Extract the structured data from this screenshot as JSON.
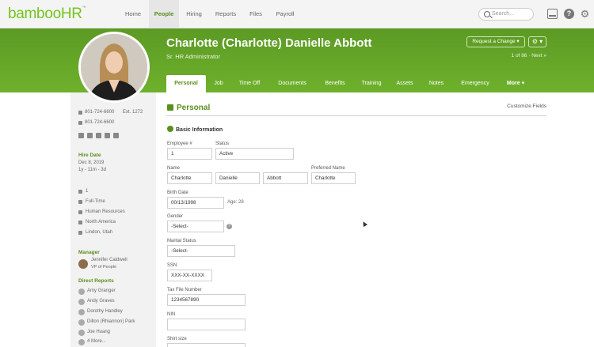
{
  "nav": {
    "logo": "bambooHR",
    "logo_tm": "™",
    "items": [
      "Home",
      "People",
      "Hiring",
      "Reports",
      "Files",
      "Payroll"
    ],
    "search_placeholder": "Search..."
  },
  "header": {
    "name": "Charlotte (Charlotte) Danielle Abbott",
    "title": "Sr. HR Administrator",
    "request_change": "Request a Change ▾",
    "settings": "⚙ ▾",
    "pager": "1 of 86 · Next »"
  },
  "tabs": [
    "Personal",
    "Job",
    "Time Off",
    "Documents",
    "Benefits",
    "Training",
    "Assets",
    "Notes",
    "Emergency",
    "More ▾"
  ],
  "sidebar": {
    "phone_work": "801-724-6600",
    "phone_ext": "Ext. 1272",
    "phone_mobile": "801-724-6600",
    "hire_date_label": "Hire Date",
    "hire_date": "Dec 8, 2019",
    "hire_duration": "1y - 11m - 3d",
    "employee_number": "1",
    "employment_type": "Full-Time",
    "department": "Human Resources",
    "division": "North America",
    "location": "Lindon, Utah",
    "manager_label": "Manager",
    "manager_name": "Jennifer Caldwell",
    "manager_title": "VP of People",
    "direct_reports_label": "Direct Reports",
    "direct_reports": [
      "Amy Granger",
      "Andy Graves",
      "Dorothy Handley",
      "Dillon (Rhiannon) Park",
      "Joe Huang",
      "4 More..."
    ]
  },
  "main": {
    "section_title": "Personal",
    "customize": "Customize Fields",
    "basic_info": "Basic Information",
    "employee_no_label": "Employee #",
    "employee_no": "1",
    "status_label": "Status",
    "status": "Active",
    "name_label": "Name",
    "first_name": "Charlotte",
    "middle_name": "Danielle",
    "last_name": "Abbott",
    "preferred_name_label": "Preferred Name",
    "preferred_name": "Charlotte",
    "birth_date_label": "Birth Date",
    "birth_date": "00/13/1998",
    "age": "Age: 28",
    "gender_label": "Gender",
    "gender": "-Select-",
    "marital_label": "Marital Status",
    "marital": "-Select-",
    "ssn_label": "SSN",
    "ssn": "XXX-XX-XXXX",
    "tfn_label": "Tax File Number",
    "tfn": "1234567890",
    "nin_label": "NIN",
    "shirt_label": "Shirt size"
  },
  "colors": {
    "brand_green": "#6eb12c",
    "accent_green": "#5a8f1e"
  }
}
